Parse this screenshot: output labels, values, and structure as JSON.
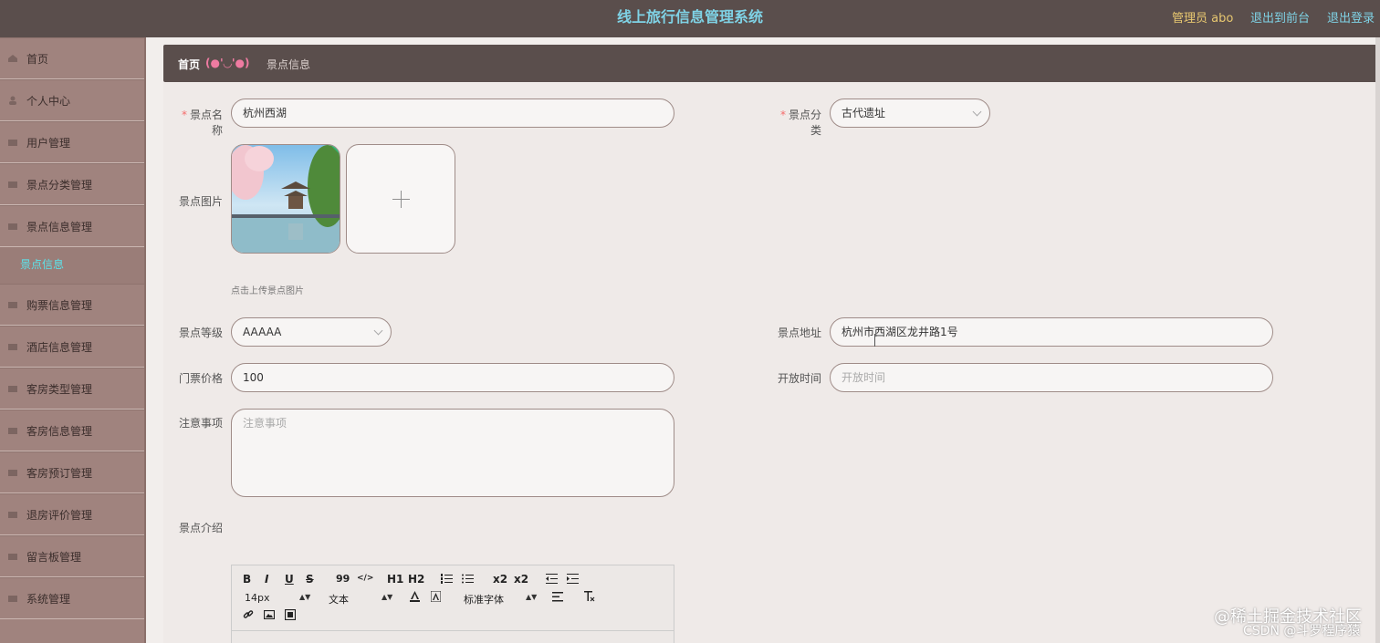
{
  "header": {
    "title": "线上旅行信息管理系统",
    "admin": "管理员 abo",
    "to_front": "退出到前台",
    "logout": "退出登录"
  },
  "sidebar": {
    "items": [
      {
        "label": "首页"
      },
      {
        "label": "个人中心"
      },
      {
        "label": "用户管理"
      },
      {
        "label": "景点分类管理"
      },
      {
        "label": "景点信息管理"
      },
      {
        "label": "购票信息管理"
      },
      {
        "label": "酒店信息管理"
      },
      {
        "label": "客房类型管理"
      },
      {
        "label": "客房信息管理"
      },
      {
        "label": "客房预订管理"
      },
      {
        "label": "退房评价管理"
      },
      {
        "label": "留言板管理"
      },
      {
        "label": "系统管理"
      }
    ],
    "sub_active": "景点信息"
  },
  "breadcrumb": {
    "home": "首页",
    "face": "(●'◡'●)",
    "current": "景点信息"
  },
  "form": {
    "name_label": "景点名称",
    "name_value": "杭州西湖",
    "category_label": "景点分类",
    "category_value": "古代遗址",
    "image_label": "景点图片",
    "image_hint": "点击上传景点图片",
    "level_label": "景点等级",
    "level_value": "AAAAA",
    "address_label": "景点地址",
    "address_value": "杭州市西湖区龙井路1号",
    "price_label": "门票价格",
    "price_value": "100",
    "open_label": "开放时间",
    "open_placeholder": "开放时间",
    "notes_label": "注意事项",
    "notes_placeholder": "注意事项",
    "intro_label": "景点介绍"
  },
  "editor": {
    "bold": "B",
    "italic": "I",
    "underline": "U",
    "strike": "S",
    "quote": "99",
    "code": "</>",
    "h1": "H1",
    "h2": "H2",
    "sub": "x2",
    "sup": "x2",
    "size": "14px",
    "paragraph": "文本",
    "font": "标准字体"
  },
  "watermark": {
    "line1": "@稀土掘金技术社区",
    "line2": "CSDN @斗罗程序猿"
  }
}
